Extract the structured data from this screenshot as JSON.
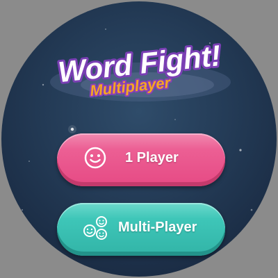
{
  "game": {
    "title": "Word Fight!",
    "subtitle": "Multiplayer"
  },
  "menu": {
    "one_player_label": "1 Player",
    "multi_player_label": "Multi-Player"
  },
  "colors": {
    "background": "#8b8b8b",
    "sky": "#233a55",
    "one_player_button": "#ec5f94",
    "multi_player_button": "#3ec6b8",
    "title_outline": "#7a3fb4",
    "subtitle_fill": "#f5a623"
  },
  "icons": {
    "one_player": "smiley-face-icon",
    "multi_player": "group-faces-icon"
  }
}
